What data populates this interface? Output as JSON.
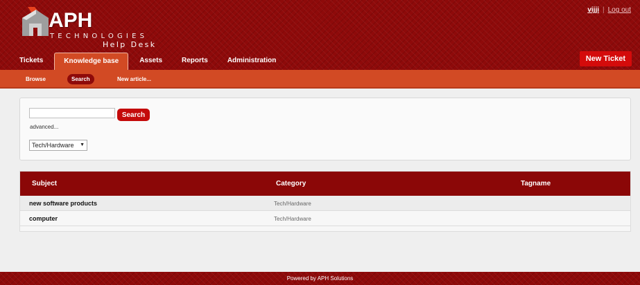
{
  "brand": {
    "name": "APH",
    "line2": "TECHNOLOGIES",
    "line3": "Help Desk"
  },
  "user": {
    "username": "vijji",
    "separator": "|",
    "logout": "Log out"
  },
  "nav": {
    "tabs": [
      "Tickets",
      "Knowledge base",
      "Assets",
      "Reports",
      "Administration"
    ],
    "active": "Knowledge base",
    "new_ticket": "New Ticket"
  },
  "subnav": {
    "browse": "Browse",
    "search": "Search",
    "new_article": "New article..."
  },
  "search": {
    "value": "",
    "button": "Search",
    "advanced": "advanced...",
    "category_selected": "Tech/Hardware"
  },
  "results": {
    "columns": [
      "Subject",
      "Category",
      "Tagname"
    ],
    "rows": [
      {
        "subject": "new software products",
        "category": "Tech/Hardware",
        "tagname": ""
      },
      {
        "subject": "computer",
        "category": "Tech/Hardware",
        "tagname": ""
      }
    ]
  },
  "footer": {
    "text": "Powered by APH Solutions"
  },
  "colors": {
    "header": "#8e0a0a",
    "subnav": "#d24a24",
    "accent": "#d40b0b"
  }
}
